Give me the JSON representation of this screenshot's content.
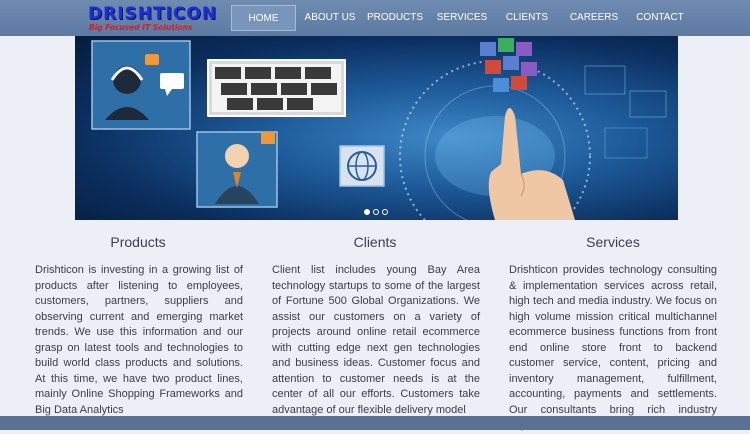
{
  "logo": {
    "name": "DRISHTICON",
    "tagline": "Big Focused IT Solutions"
  },
  "nav": {
    "items": [
      {
        "label": "HOME",
        "active": true
      },
      {
        "label": "ABOUT US",
        "active": false
      },
      {
        "label": "PRODUCTS",
        "active": false
      },
      {
        "label": "SERVICES",
        "active": false
      },
      {
        "label": "CLIENTS",
        "active": false
      },
      {
        "label": "CAREERS",
        "active": false
      },
      {
        "label": "CONTACT",
        "active": false
      }
    ]
  },
  "slider": {
    "slide_count": 3,
    "active_index": 0
  },
  "columns": [
    {
      "title": "Products",
      "text": "Drishticon is investing in a growing list of products after listening to employees, customers, partners, suppliers and observing current and emerging market trends. We use this information and our grasp on latest tools and technologies to build world class products and solutions. At this time, we have two product lines, mainly Online Shopping Frameworks and Big Data Analytics"
    },
    {
      "title": "Clients",
      "text": "Client list includes young Bay Area technology startups to some of the largest of Fortune 500 Global Organizations. We assist our customers on a variety of projects around online retail ecommerce with cutting edge next gen technologies and business ideas. Customer focus and attention to customer needs is at the center of all our efforts. Customers take advantage of our flexible delivery model"
    },
    {
      "title": "Services",
      "text": "Drishticon provides technology consulting & implementation services across retail, high tech and media industry. We focus on high volume mission critical multichannel ecommerce business functions from front end online store front to backend customer service, content, pricing and inventory management, fulfillment, accounting, payments and settlements. Our consultants bring rich industry experience"
    }
  ],
  "colors": {
    "navbar": "#5d7aa2",
    "logo": "#1a2fd8",
    "tagline": "#d21f1f",
    "footer": "#5a7193"
  }
}
